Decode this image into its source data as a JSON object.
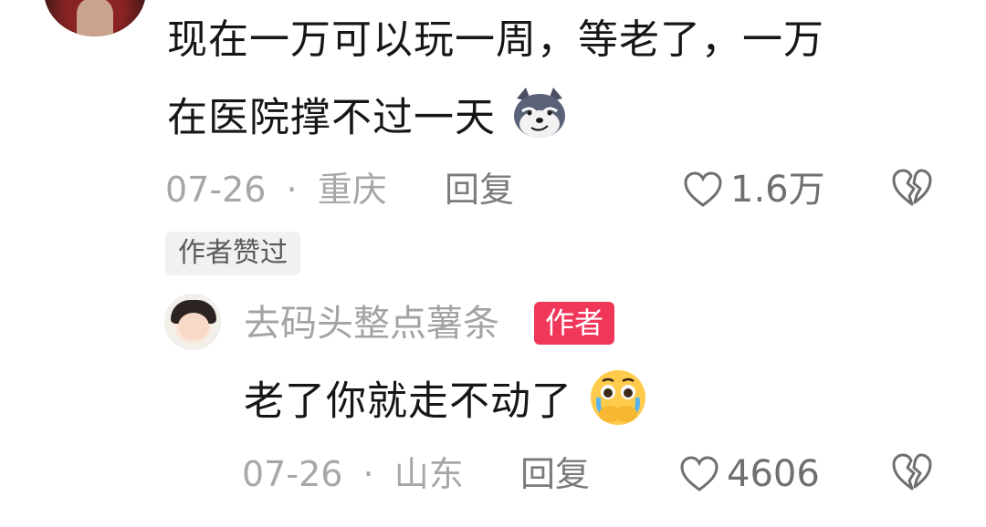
{
  "comment": {
    "text_line1": "现在一万可以玩一周，等老了，一万",
    "text_line2": "在医院撑不过一天",
    "emoji": "dog-smirk-emoji",
    "date": "07-26",
    "separator": "·",
    "location": "重庆",
    "reply_label": "回复",
    "likes": "1.6万",
    "author_liked_badge": "作者赞过"
  },
  "reply": {
    "username": "去码头整点薯条",
    "author_tag": "作者",
    "text": "老了你就走不动了",
    "emoji": "pleading-crying-emoji",
    "date": "07-26",
    "separator": "·",
    "location": "山东",
    "reply_label": "回复",
    "likes": "4606"
  },
  "colors": {
    "text": "#161616",
    "meta": "#a7a7a9",
    "author_tag_bg": "#f0375a"
  }
}
